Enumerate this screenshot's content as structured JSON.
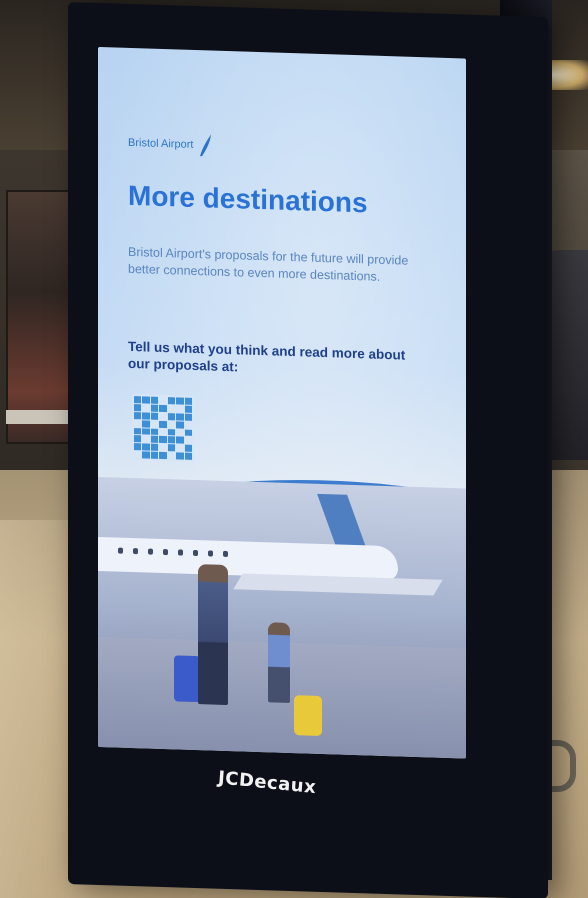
{
  "ad": {
    "brand_name": "Bristol Airport",
    "headline": "More destinations",
    "body": "Bristol Airport's proposals for the future will provide better connections to even more destinations.",
    "call_to_action": "Tell us what you think and read more about our proposals at:"
  },
  "kiosk": {
    "sponsor_logo_text": "JCDecaux"
  },
  "colors": {
    "headline": "#2a72d6",
    "screen_background": "#c6dcf4",
    "kiosk_frame": "#0d0f18"
  }
}
